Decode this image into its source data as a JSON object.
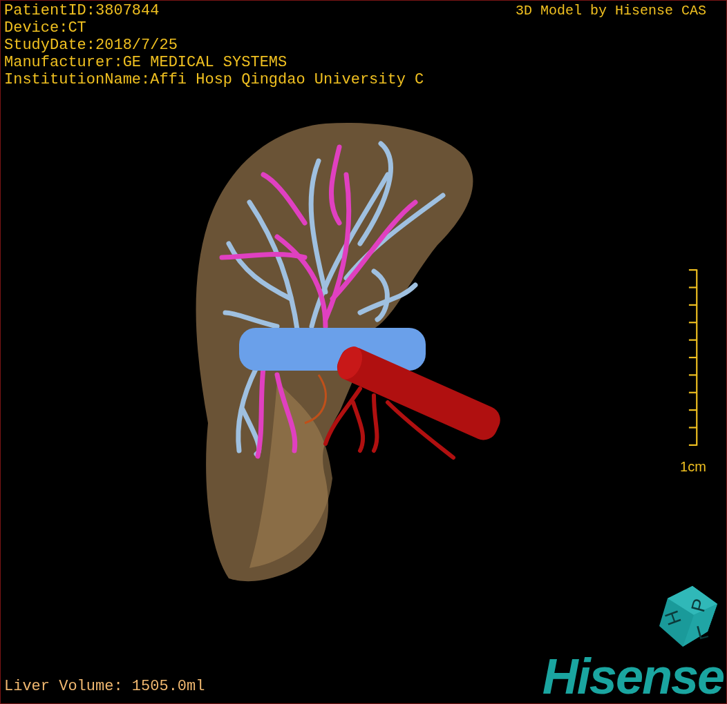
{
  "info_lines": [
    "PatientID:3807844",
    "Device:CT",
    "StudyDate:2018/7/25",
    "Manufacturer:GE MEDICAL SYSTEMS",
    "InstitutionName:Affi Hosp Qingdao University C"
  ],
  "title": "3D Model by Hisense CAS",
  "scale_bar": {
    "label": "1cm"
  },
  "orientation_cube": {
    "labels": [
      "H",
      "P",
      "L"
    ]
  },
  "status": "Liver Volume: 1505.0ml",
  "logo": "Hisense"
}
